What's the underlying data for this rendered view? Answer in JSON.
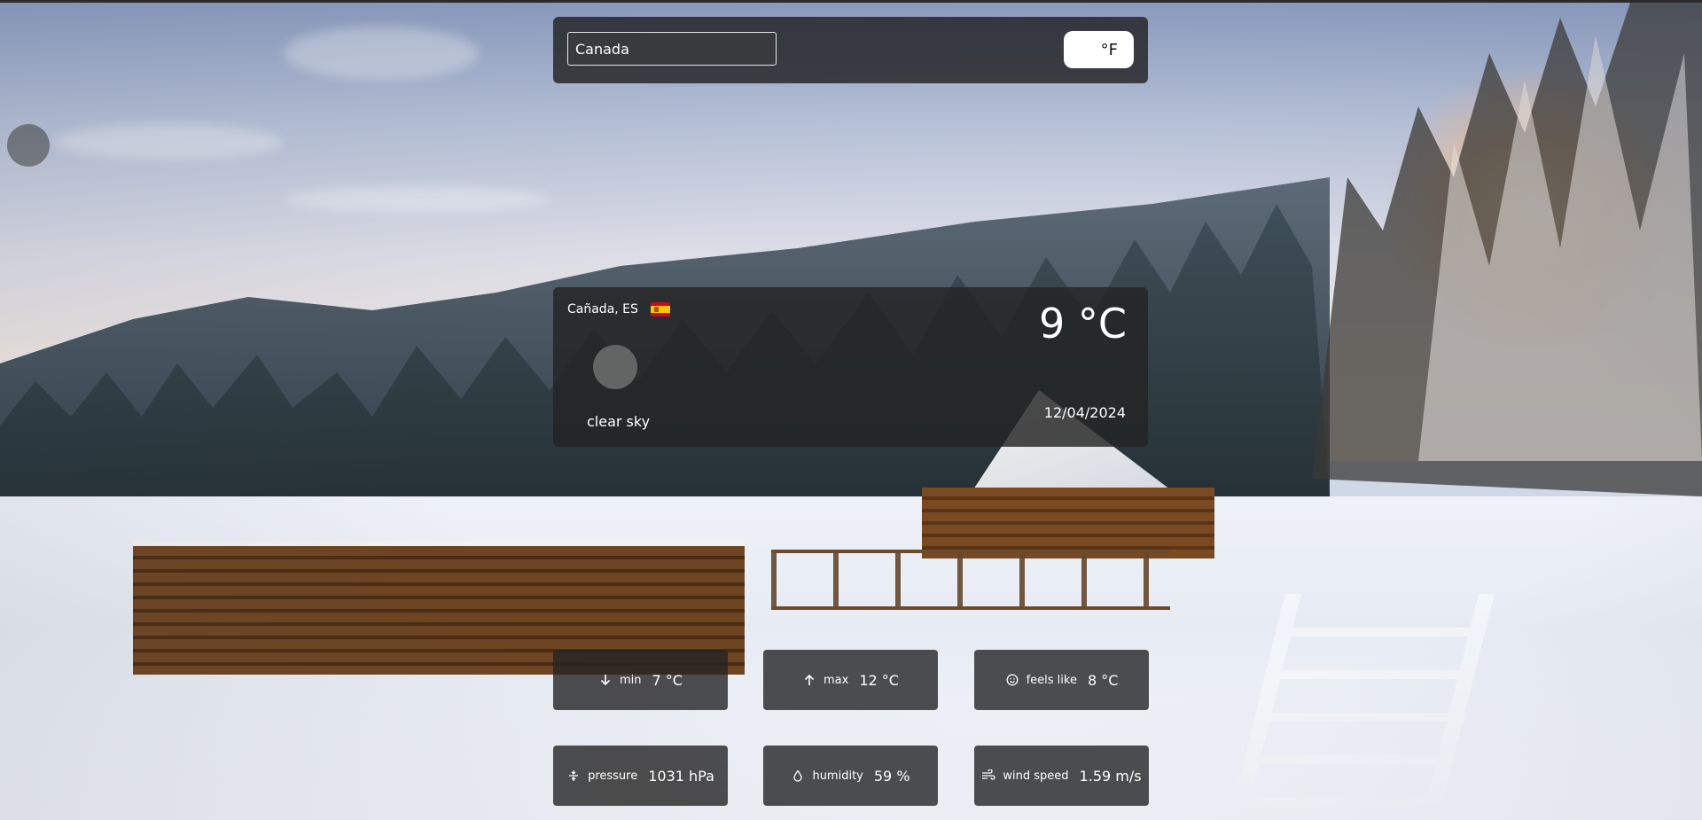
{
  "search": {
    "value": "Canada",
    "placeholder": ""
  },
  "unit_toggle": {
    "label": "°F"
  },
  "current": {
    "location": "Cañada, ES",
    "temperature": "9 °C",
    "description": "clear sky",
    "date": "12/04/2024"
  },
  "stats": [
    {
      "icon": "arrow-down-icon",
      "label": "min",
      "value": "7 °C"
    },
    {
      "icon": "arrow-up-icon",
      "label": "max",
      "value": "12 °C"
    },
    {
      "icon": "smile-icon",
      "label": "feels like",
      "value": "8 °C"
    },
    {
      "icon": "pressure-icon",
      "label": "pressure",
      "value": "1031 hPa"
    },
    {
      "icon": "droplet-icon",
      "label": "humidity",
      "value": "59 %"
    },
    {
      "icon": "wind-icon",
      "label": "wind speed",
      "value": "1.59 m/s"
    }
  ],
  "colors": {
    "panel": "#232323",
    "toggle_bg": "#ffffff",
    "flag_red": "#c60b1e",
    "flag_yellow": "#ffc400"
  }
}
